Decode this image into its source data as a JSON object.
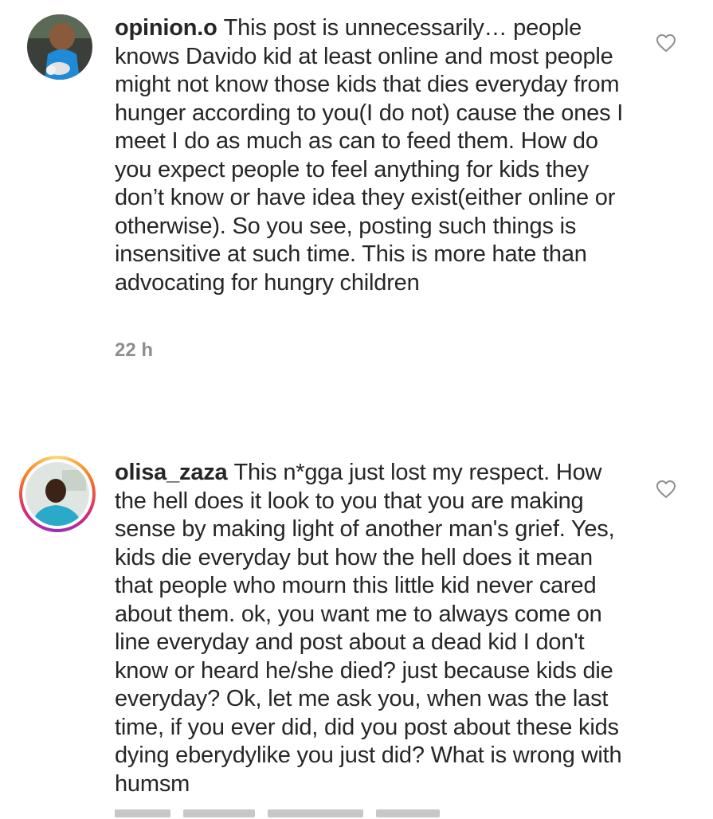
{
  "comments": [
    {
      "username": "opinion.o",
      "body": "This post is unnecessarily… people knows Davido kid at least online and most people might not know those kids that dies everyday from hunger according to you(I do not) cause the ones I meet I do as much as can to feed them. How do you expect people to feel anything for kids they don’t know or have idea they exist(either online or otherwise). So you see, posting such things is insensitive at such time. This is more hate than advocating for hungry children",
      "time": "22 h",
      "avatar_icon": "child-photo-avatar",
      "like_icon": "heart-outline-icon"
    },
    {
      "username": "olisa_zaza",
      "body": "This n*gga just lost my respect. How the hell does it look to you that you are making sense by making light of another man's grief. Yes, kids die everyday but how the hell does it mean that people who mourn this little kid never cared about them. ok, you want me to always come on line everyday and post about a dead kid I don't know or heard he/she died? just because kids die everyday? Ok, let me ask you, when was the last time, if you ever did, did you post about these kids dying eberydylike you just did? What is wrong with humsm",
      "avatar_icon": "man-photo-avatar-with-story-ring",
      "like_icon": "heart-outline-icon"
    }
  ],
  "colors": {
    "text": "#262626",
    "meta": "#8e8e8e",
    "story_ring": [
      "#feda75",
      "#fa7e1e",
      "#d62976",
      "#962fbf"
    ]
  }
}
